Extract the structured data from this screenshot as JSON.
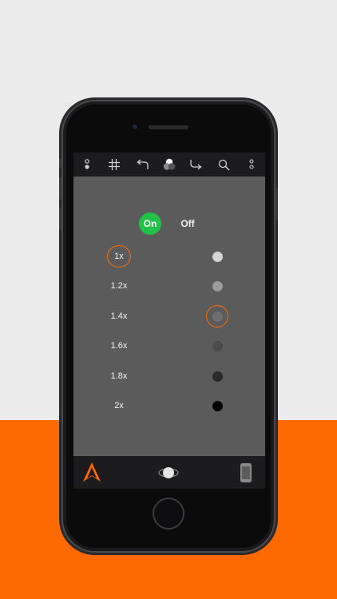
{
  "toolbar": {
    "icons": [
      "flash-icon",
      "grid-icon",
      "undo-icon",
      "color-filter-icon",
      "redo-icon",
      "search-icon",
      "more-icon"
    ]
  },
  "toggle": {
    "on_label": "On",
    "off_label": "Off",
    "active": "On",
    "active_color": "#22c14a"
  },
  "zoom_levels": [
    {
      "label": "1x",
      "selected": true
    },
    {
      "label": "1.2x",
      "selected": false
    },
    {
      "label": "1.4x",
      "selected": false
    },
    {
      "label": "1.6x",
      "selected": false
    },
    {
      "label": "1.8x",
      "selected": false
    },
    {
      "label": "2x",
      "selected": false
    }
  ],
  "tone_dots": [
    {
      "color": "#d4d4d4",
      "selected": false
    },
    {
      "color": "#9b9b9b",
      "selected": false
    },
    {
      "color": "#6e6e6e",
      "selected": true
    },
    {
      "color": "#4b4b4b",
      "selected": false
    },
    {
      "color": "#2a2a2a",
      "selected": false
    },
    {
      "color": "#000000",
      "selected": false
    }
  ],
  "colors": {
    "accent": "#ff6a00",
    "panel": "#5b5b5b",
    "bar": "#1c1c1e"
  },
  "bottombar": {
    "icons": [
      "app-logo-icon",
      "shutter-icon",
      "device-icon"
    ]
  }
}
